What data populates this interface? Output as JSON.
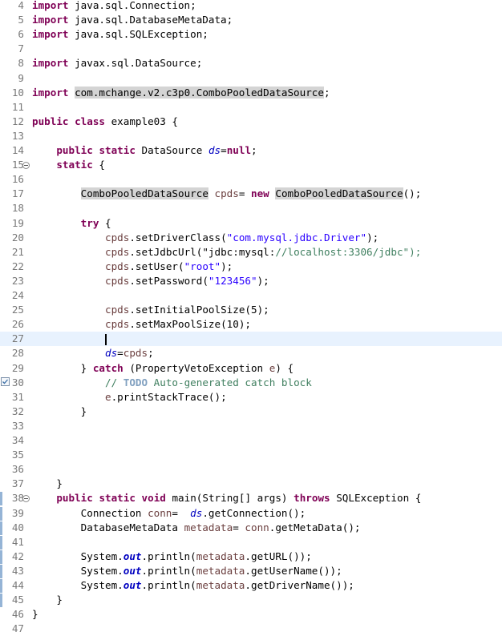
{
  "editor": {
    "language": "java",
    "current_line": 27,
    "first_line_number": 4,
    "lines": [
      {
        "n": "4",
        "code": "import java.sql.Connection;"
      },
      {
        "n": "5",
        "code": "import java.sql.DatabaseMetaData;"
      },
      {
        "n": "6",
        "code": "import java.sql.SQLException;"
      },
      {
        "n": "7",
        "code": ""
      },
      {
        "n": "8",
        "code": "import javax.sql.DataSource;"
      },
      {
        "n": "9",
        "code": ""
      },
      {
        "n": "10",
        "code": "import com.mchange.v2.c3p0.ComboPooledDataSource;"
      },
      {
        "n": "11",
        "code": ""
      },
      {
        "n": "12",
        "code": "public class example03 {"
      },
      {
        "n": "13",
        "code": ""
      },
      {
        "n": "14",
        "code": "    public static DataSource ds=null;"
      },
      {
        "n": "15",
        "code": "    static {"
      },
      {
        "n": "16",
        "code": ""
      },
      {
        "n": "17",
        "code": "        ComboPooledDataSource cpds= new ComboPooledDataSource();"
      },
      {
        "n": "18",
        "code": ""
      },
      {
        "n": "19",
        "code": "        try {"
      },
      {
        "n": "20",
        "code": "            cpds.setDriverClass(\"com.mysql.jdbc.Driver\");"
      },
      {
        "n": "21",
        "code": "            cpds.setJdbcUrl(\"jdbc:mysql://localhost:3306/jdbc\");"
      },
      {
        "n": "22",
        "code": "            cpds.setUser(\"root\");"
      },
      {
        "n": "23",
        "code": "            cpds.setPassword(\"123456\");"
      },
      {
        "n": "24",
        "code": ""
      },
      {
        "n": "25",
        "code": "            cpds.setInitialPoolSize(5);"
      },
      {
        "n": "26",
        "code": "            cpds.setMaxPoolSize(10);"
      },
      {
        "n": "27",
        "code": ""
      },
      {
        "n": "28",
        "code": "            ds=cpds;"
      },
      {
        "n": "29",
        "code": "        } catch (PropertyVetoException e) {"
      },
      {
        "n": "30",
        "code": "            // TODO Auto-generated catch block"
      },
      {
        "n": "31",
        "code": "            e.printStackTrace();"
      },
      {
        "n": "32",
        "code": "        }"
      },
      {
        "n": "33",
        "code": ""
      },
      {
        "n": "34",
        "code": ""
      },
      {
        "n": "35",
        "code": ""
      },
      {
        "n": "36",
        "code": ""
      },
      {
        "n": "37",
        "code": "    }"
      },
      {
        "n": "38",
        "code": "    public static void main(String[] args) throws SQLException {"
      },
      {
        "n": "39",
        "code": "        Connection conn=  ds.getConnection();"
      },
      {
        "n": "40",
        "code": "        DatabaseMetaData metadata= conn.getMetaData();"
      },
      {
        "n": "41",
        "code": ""
      },
      {
        "n": "42",
        "code": "        System.out.println(metadata.getURL());"
      },
      {
        "n": "43",
        "code": "        System.out.println(metadata.getUserName());"
      },
      {
        "n": "44",
        "code": "        System.out.println(metadata.getDriverName());"
      },
      {
        "n": "45",
        "code": "    }"
      },
      {
        "n": "46",
        "code": "}"
      },
      {
        "n": "47",
        "code": ""
      }
    ],
    "fold_lines": [
      "15",
      "38"
    ],
    "warning_lines": [
      "30"
    ],
    "marker_lines": [
      "38",
      "39",
      "40",
      "41",
      "42",
      "43",
      "44",
      "45"
    ],
    "highlight_tokens": [
      "com.mchange.v2.c3p0.ComboPooledDataSource",
      "ComboPooledDataSource"
    ],
    "icons": {
      "fold": "fold-toggle-icon",
      "warning": "task-warning-icon"
    }
  }
}
